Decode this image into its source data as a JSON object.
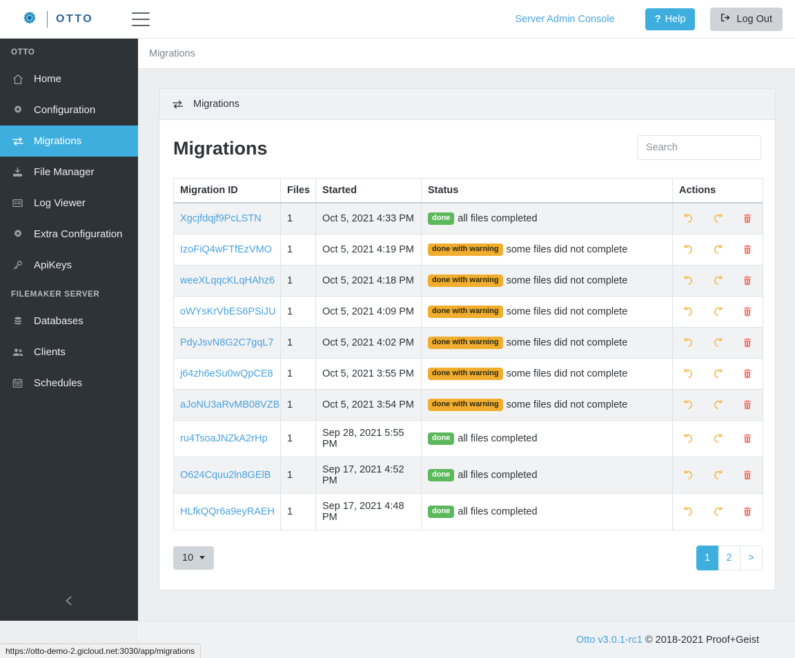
{
  "topbar": {
    "brand": "OTTO",
    "brand_icon": "gear-icon",
    "menu_icon": "hamburger-icon",
    "admin_link": "Server Admin Console",
    "help_label": "Help",
    "help_icon": "question-mark-icon",
    "logout_label": "Log Out",
    "logout_icon": "sign-out-icon",
    "help_color": "#3eaede",
    "logout_color": "#cfd2d6"
  },
  "sidebar": {
    "group1_title": "OTTO",
    "group2_title": "FILEMAKER SERVER",
    "active_item": "Migrations",
    "active_color": "#3eaede",
    "background": "#2e3338",
    "collapse_icon": "chevron-left-icon",
    "items": [
      {
        "label": "Home",
        "icon": "home-icon"
      },
      {
        "label": "Configuration",
        "icon": "gear-icon"
      },
      {
        "label": "Migrations",
        "icon": "exchange-icon"
      },
      {
        "label": "File Manager",
        "icon": "download-icon"
      },
      {
        "label": "Log Viewer",
        "icon": "list-icon"
      },
      {
        "label": "Extra Configuration",
        "icon": "gear-icon"
      },
      {
        "label": "ApiKeys",
        "icon": "key-icon"
      }
    ],
    "items2": [
      {
        "label": "Databases",
        "icon": "database-icon"
      },
      {
        "label": "Clients",
        "icon": "users-icon"
      },
      {
        "label": "Schedules",
        "icon": "calendar-icon"
      }
    ]
  },
  "breadcrumb": "Migrations",
  "card": {
    "header_label": "Migrations",
    "header_icon": "exchange-icon",
    "page_title": "Migrations"
  },
  "search": {
    "placeholder": "Search",
    "value": ""
  },
  "table": {
    "columns": [
      "Migration ID",
      "Files",
      "Started",
      "Status",
      "Actions"
    ],
    "rows": [
      {
        "id": "Xgcjfdqjf9PcLSTN",
        "files": "1",
        "started": "Oct 5, 2021 4:33 PM",
        "badge": "done",
        "badge_type": "done",
        "status": "all files completed"
      },
      {
        "id": "IzoFiQ4wFTfEzVMO",
        "files": "1",
        "started": "Oct 5, 2021 4:19 PM",
        "badge": "done with warning",
        "badge_type": "warn",
        "status": "some files did not complete"
      },
      {
        "id": "weeXLqqcKLqHAhz6",
        "files": "1",
        "started": "Oct 5, 2021 4:18 PM",
        "badge": "done with warning",
        "badge_type": "warn",
        "status": "some files did not complete"
      },
      {
        "id": "oWYsKrVbES6PSiJU",
        "files": "1",
        "started": "Oct 5, 2021 4:09 PM",
        "badge": "done with warning",
        "badge_type": "warn",
        "status": "some files did not complete"
      },
      {
        "id": "PdyJsvN8G2C7gqL7",
        "files": "1",
        "started": "Oct 5, 2021 4:02 PM",
        "badge": "done with warning",
        "badge_type": "warn",
        "status": "some files did not complete"
      },
      {
        "id": "j64zh6eSu0wQpCE8",
        "files": "1",
        "started": "Oct 5, 2021 3:55 PM",
        "badge": "done with warning",
        "badge_type": "warn",
        "status": "some files did not complete"
      },
      {
        "id": "aJoNU3aRvMB08VZB",
        "files": "1",
        "started": "Oct 5, 2021 3:54 PM",
        "badge": "done with warning",
        "badge_type": "warn",
        "status": "some files did not complete"
      },
      {
        "id": "ru4TsoaJNZkA2rHp",
        "files": "1",
        "started": "Sep 28, 2021 5:55 PM",
        "badge": "done",
        "badge_type": "done",
        "status": "all files completed"
      },
      {
        "id": "O624Cquu2ln8GElB",
        "files": "1",
        "started": "Sep 17, 2021 4:52 PM",
        "badge": "done",
        "badge_type": "done",
        "status": "all files completed"
      },
      {
        "id": "HLfkQQr6a9eyRAEH",
        "files": "1",
        "started": "Sep 17, 2021 4:48 PM",
        "badge": "done",
        "badge_type": "done",
        "status": "all files completed"
      }
    ],
    "action_icons": [
      "undo-icon",
      "redo-icon",
      "trash-icon"
    ],
    "badge_done_color": "#5cb85c",
    "badge_warn_color": "#f0ad2e"
  },
  "pagination": {
    "per_page": "10",
    "pages": [
      "1",
      "2",
      ">"
    ],
    "active_page": "1"
  },
  "footer": {
    "version": "Otto v3.0.1-rc1",
    "copyright": "© 2018-2021 Proof+Geist"
  },
  "status_url": "https://otto-demo-2.gicloud.net:3030/app/migrations"
}
